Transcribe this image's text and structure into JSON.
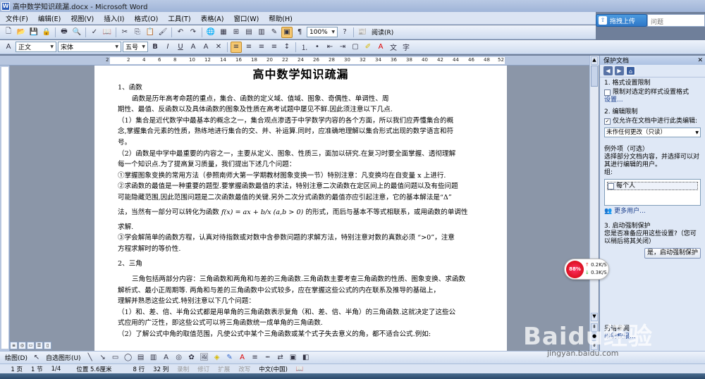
{
  "window": {
    "title": "高中数学知识疏漏.docx - Microsoft Word"
  },
  "menu": [
    "文件(F)",
    "编辑(E)",
    "视图(V)",
    "插入(I)",
    "格式(O)",
    "工具(T)",
    "表格(A)",
    "窗口(W)",
    "帮助(H)"
  ],
  "upload": {
    "label": "拖拽上传",
    "question_placeholder": "问题"
  },
  "toolbar": {
    "zoom": "100%",
    "read_label": "阅读(R)"
  },
  "format": {
    "style": "正文",
    "font": "宋体",
    "size": "五号"
  },
  "ruler": {
    "labels": [
      "2",
      "2",
      "4",
      "6",
      "8",
      "10",
      "12",
      "14",
      "16",
      "18",
      "20",
      "22",
      "24",
      "26",
      "28",
      "30",
      "32",
      "34",
      "36",
      "38",
      "40",
      "42",
      "44",
      "46",
      "48",
      "52"
    ]
  },
  "document": {
    "title": "高中数学知识疏漏",
    "lines": [
      "1、函数",
      "函数是历年高考命题的重点，集合、函数的定义域、值域、图象、奇偶性、单调性、周",
      "期性、最值、反函数以及具体函数的图象及性质在高考试题中屡见不鲜.因此须注意以下几点.",
      "（1）集合是近代数学中最基本的概念之一，集合观点渗透于中学数学内容的各个方面，所以我们应弄懂集合的概",
      "念,掌握集合元素的性质，熟练地进行集合的交、并、补运算.同时，应准确地理解以集合形式出现的数学语言和符",
      "号。",
      "（2）函数是中学中最重要的内容之一，主要从定义、图象、性质三，面加以研究.在复习时要全面掌握、透彻理解",
      "每一个知识点.为了提高复习质量，我们提出下述几个问题：",
      "①掌握图象变换的常用方法（参照南师大第一学期教材图象变换一节）特别注意：凡变换均在自变量 x 上进行.",
      "②求函数的最值是一种重要的题型.要掌握函数最值的求法，特别注意二次函数在定区间上的最值问题以及有些问题",
      "可能隐藏范围,因此范围问题是二次函数最值的关键.另外二次分式函数的最值亦应引起注意，它的基本解法是“Δ”",
      "法，当然有一部分可以转化为函数",
      "的形式，而后与基本不等式相联系，或用函数的单调性",
      "求解.",
      "③学会解简单的函数方程，认真对待指数或对数中含参数问题的求解方法，特别注意对数的真数必须 “>0”，注意",
      "方程求解时的等价性.",
      "2、三角",
      "三角包括两部分内容：三角函数和两角和与差的三角函数.三角函数主要考查三角函数的性质、图象变换、求函数",
      "解析式、最小正周期等.  两角和与差的三角函数中公式较多，应在掌握这些公式的内在联系及推导的基础上，",
      "理解并熟悉这些公式.特别注意以下几个问题：",
      "（1）和、差、倍、半角公式都是用单角的三角函数表示复角（和、差、倍、半角）的三角函数.这就决定了这些公",
      "式应用的广泛性，即这些公式可以将三角函数统一成单角的三角函数.",
      "（2）了解公式中角的取值范围，凡使公式中某个三角函数或某个式子失去意义的角，都不适合公式.例如:"
    ],
    "formula": "f(x) = ax + b/x (a,b > 0)"
  },
  "panel": {
    "title": "保护文档",
    "s1_title": "1. 格式设置限制",
    "s1_check": "限制对选定的样式设置格式",
    "s1_link": "设置...",
    "s2_title": "2. 编辑限制",
    "s2_check": "仅允许在文档中进行此类编辑:",
    "s2_combo": "未作任何更改（只读）",
    "exceptions_title": "例外项（可选）",
    "exceptions_desc": "选择部分文档内容，并选择可以对其进行编辑的用户。",
    "group_label": "组:",
    "group_item": "每个人",
    "more_users": "更多用户...",
    "s3_title": "3. 启动强制保护",
    "s3_desc": "您是否准备应用这些设置?（您可以稍后将其关闭）",
    "s3_button": "是，启动强制保护",
    "footer_a": "另请参阅",
    "footer_b": "限制权限..."
  },
  "network": {
    "percent": "88%",
    "up": "0.2K/S",
    "down": "0.3K/S"
  },
  "drawbar": {
    "draw": "绘图(D)",
    "autoshape": "自选图形(U)"
  },
  "status": {
    "page": "1 页",
    "section": "1 节",
    "pages": "1/4",
    "position": "位置 5.6厘米",
    "line": "8 行",
    "column": "32 列",
    "rec": "录制",
    "trk": "修订",
    "ext": "扩展",
    "ovr": "改写",
    "lang": "中文(中国)"
  },
  "watermark": {
    "brand": "Baidu经验",
    "url": "jingyan.baidu.com"
  }
}
